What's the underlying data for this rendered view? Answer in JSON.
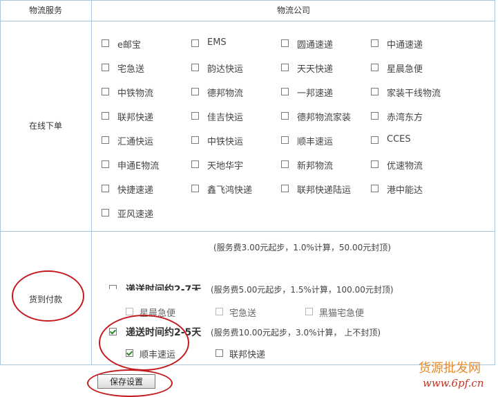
{
  "header": {
    "service_col": "物流服务",
    "company_col": "物流公司"
  },
  "online_order": {
    "label": "在线下单",
    "companies": [
      "e邮宝",
      "EMS",
      "圆通速递",
      "中通速递",
      "宅急送",
      "韵达快运",
      "天天快递",
      "星晨急便",
      "中铁物流",
      "德邦物流",
      "一邦速递",
      "家装干线物流",
      "联邦快递",
      "佳吉快运",
      "德邦物流家装",
      "赤湾东方",
      "汇通快运",
      "中铁快运",
      "顺丰速运",
      "CCES",
      "申通E物流",
      "天地华宇",
      "新邦物流",
      "优速物流",
      "快捷速递",
      "鑫飞鸿快递",
      "联邦快递陆运",
      "港中能达",
      "亚风速递"
    ]
  },
  "cod": {
    "label": "货到付款",
    "tier1_fee": "(服务费3.00元起步，1.0%计算，50.00元封顶)",
    "tier2_title": "递送时间约2-7天",
    "tier2_fee": "(服务费5.00元起步，1.5%计算，100.00元封顶)",
    "tier2_options": [
      "星晨急便",
      "宅急送",
      "黑猫宅急便"
    ],
    "tier3_title": "递送时间约2-5天",
    "tier3_fee": "(服务费10.00元起步，3.0%计算， 上不封顶)",
    "tier3_options": [
      "顺丰速运",
      "联邦快递"
    ]
  },
  "footer": {
    "save_label": "保存设置"
  },
  "watermark": {
    "main": "货源批发网",
    "sub": "www.6pf.cn"
  },
  "colors": {
    "border": "#a9c4dd",
    "annotation": "#c4191c",
    "watermark": "#e78a2b"
  }
}
